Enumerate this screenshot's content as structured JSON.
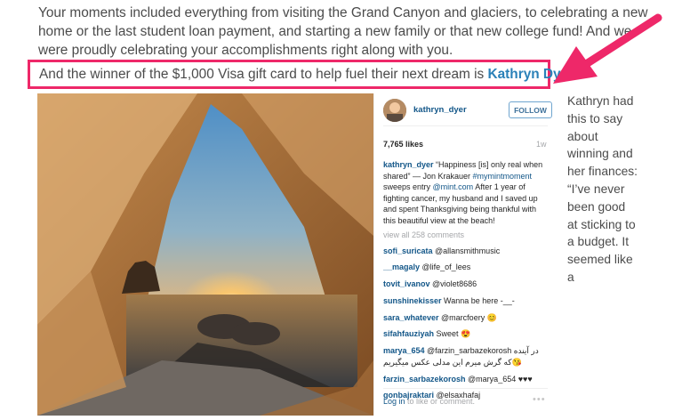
{
  "article": {
    "intro": "Your moments included everything from visiting the Grand Canyon and glaciers, to celebrating a new home or the last student loan payment, and starting a new family or that new college fund! And we were proudly celebrating your accomplishments right along with you.",
    "callout_prefix": "And the winner of the $1,000 Visa gift card to help fuel their next dream is ",
    "winner_name": "Kathryn Dyer!",
    "side_text": "Kathryn had this to say about winning and her finances: “I’ve never been good at sticking to a budget. It seemed like a"
  },
  "colors": {
    "highlight": "#ee2869",
    "link": "#2a81b8",
    "ig_link": "#125688"
  },
  "instagram": {
    "username": "kathryn_dyer",
    "follow_label": "FOLLOW",
    "likes": "7,765 likes",
    "age": "1w",
    "caption_user": "kathryn_dyer",
    "caption_text_1": " “Happiness [is] only real when shared” — Jon Krakauer ",
    "caption_tag": "#mymintmoment",
    "caption_text_2": " sweeps entry ",
    "caption_mention": "@mint.com",
    "caption_text_3": " After 1 year of fighting cancer, my husband and I saved up and spent Thanksgiving being thankful with this beautiful view at the beach!",
    "view_all": "view all 258 comments",
    "comments": [
      {
        "user": "sofi_suricata",
        "text": " @allansmithmusic"
      },
      {
        "user": "__magaly",
        "text": " @life_of_lees"
      },
      {
        "user": "tovit_ivanov",
        "text": " @violet8686"
      },
      {
        "user": "sunshinekisser",
        "text": " Wanna be here -__-"
      },
      {
        "user": "sara_whatever",
        "text": " @marcfoery 😊"
      },
      {
        "user": "sifahfauziyah",
        "text": " Sweet 😍"
      },
      {
        "user": "marya_654",
        "text": " @farzin_sarbazekorosh در آینده 😘که گرش میرم این مدلی عکس میگیریم"
      },
      {
        "user": "farzin_sarbazekorosh",
        "text": " @marya_654 ♥♥♥"
      },
      {
        "user": "gonbajraktari",
        "text": " @elsaxhafaj"
      }
    ],
    "login_link": "Log in",
    "login_text": " to like or comment.",
    "more_icon": "ellipsis-icon"
  }
}
